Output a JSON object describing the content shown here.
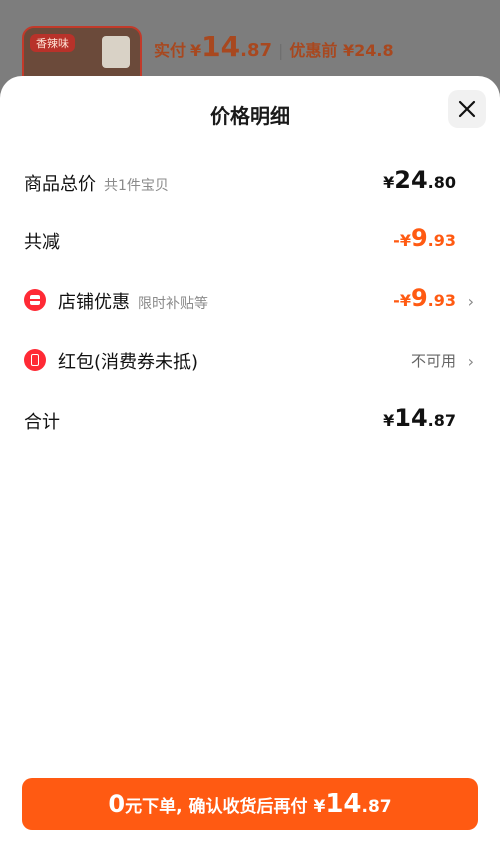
{
  "background": {
    "thumb_tag": "香辣味",
    "price_label": "实付",
    "yen": "¥",
    "price_int": "14",
    "price_dec": ".87",
    "separator": "|",
    "before_label": "优惠前",
    "before_price": "¥24.8"
  },
  "sheet": {
    "title": "价格明细"
  },
  "rows": {
    "total": {
      "label": "商品总价",
      "sub": "共1件宝贝",
      "yen": "¥",
      "int": "24",
      "dec": ".80"
    },
    "reduced": {
      "label": "共减",
      "prefix": "-¥",
      "int": "9",
      "dec": ".93"
    },
    "store_discount": {
      "label": "店铺优惠",
      "sub": "限时补贴等",
      "prefix": "-¥",
      "int": "9",
      "dec": ".93"
    },
    "red_packet": {
      "label": "红包(消费券未抵)",
      "status": "不可用"
    },
    "sum": {
      "label": "合计",
      "yen": "¥",
      "int": "14",
      "dec": ".87"
    }
  },
  "pay_button": {
    "zero": "0",
    "text": "元下单, 确认收货后再付",
    "yen": "¥",
    "int": "14",
    "dec": ".87"
  },
  "colors": {
    "accent": "#ff5a12",
    "icon_red": "#ff2a35"
  }
}
